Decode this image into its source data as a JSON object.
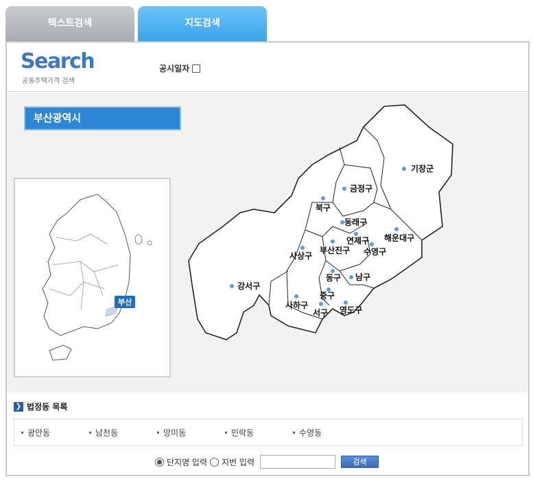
{
  "tabs": [
    {
      "label": "텍스트검색",
      "active": false
    },
    {
      "label": "지도검색",
      "active": true
    }
  ],
  "header": {
    "logo_text": "Search",
    "logo_sub": "공동주택가격 검색",
    "pub_date_label": "공시일자"
  },
  "map": {
    "city": "부산광역시",
    "selected_region": "부산",
    "districts": [
      "기장군",
      "금정구",
      "북구",
      "동래구",
      "해운대구",
      "연제구",
      "사상구",
      "부산진구",
      "수영구",
      "강서구",
      "동구",
      "남구",
      "중구",
      "사하구",
      "서구",
      "영도구"
    ]
  },
  "dong_list": {
    "title": "법정동 목록",
    "items": [
      "광안동",
      "남천동",
      "망미동",
      "민락동",
      "수영동"
    ]
  },
  "search": {
    "option_complex": "단지명 입력",
    "option_lot": "지번 입력",
    "button": "검색"
  },
  "colors": {
    "accent": "#2e86d6",
    "tab_active": "#3aa5ea",
    "tab_inactive": "#b0b2b6"
  }
}
